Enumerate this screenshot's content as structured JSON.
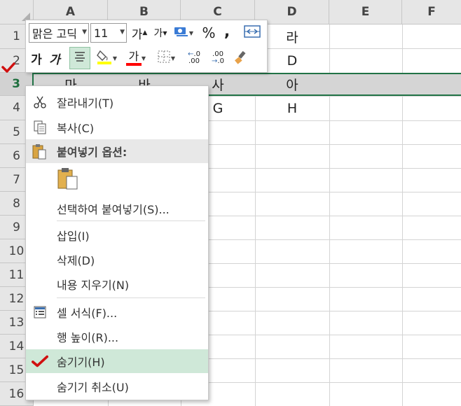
{
  "columns": [
    "A",
    "B",
    "C",
    "D",
    "E",
    "F"
  ],
  "rows": [
    "1",
    "2",
    "3",
    "4",
    "5",
    "6",
    "7",
    "8",
    "9",
    "10",
    "11",
    "12",
    "13",
    "14",
    "15",
    "16"
  ],
  "cells": {
    "D1": "라",
    "D2": "D",
    "A3": "마",
    "B3": "바",
    "C3": "사",
    "D3": "아",
    "C4": "G",
    "D4": "H"
  },
  "selected_row": "3",
  "mini_toolbar": {
    "font_name": "맑은 고딕",
    "font_size": "11",
    "grow_font": "가",
    "shrink_font": "가",
    "percent": "%",
    "comma": ",",
    "bold": "가",
    "italic": "가",
    "font_color_letter": "가",
    "inc_decimal_top": ".0",
    "inc_decimal_bottom": ".00",
    "dec_decimal_top": ".00",
    "dec_decimal_bottom": ".0",
    "colors": {
      "highlight": "#ffff00",
      "font": "#ff0000"
    }
  },
  "context_menu": {
    "cut": "잘라내기(T)",
    "copy": "복사(C)",
    "paste_options": "붙여넣기 옵션:",
    "paste_special": "선택하여 붙여넣기(S)...",
    "insert": "삽입(I)",
    "delete": "삭제(D)",
    "clear_contents": "내용 지우기(N)",
    "format_cells": "셀 서식(F)...",
    "row_height": "행 높이(R)...",
    "hide": "숨기기(H)",
    "unhide": "숨기기 취소(U)"
  },
  "icons": {
    "cut": "scissors-icon",
    "copy": "copy-icon",
    "paste_options": "clipboard-icon",
    "format_cells": "format-cells-icon",
    "hide_check": "red-checkmark-icon",
    "row_check": "red-checkmark-icon"
  },
  "accent_color": "#217346",
  "highlight_color": "#cfe8d8"
}
